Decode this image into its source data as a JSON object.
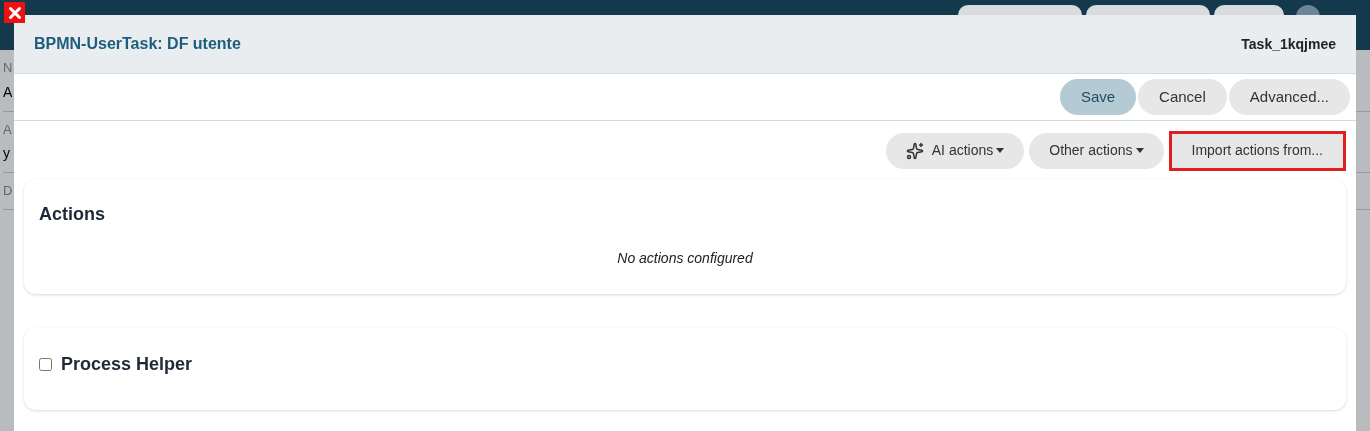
{
  "background": {
    "fields": [
      {
        "label": "N",
        "value": "A"
      },
      {
        "label": "A",
        "value": "y"
      },
      {
        "label": "D"
      }
    ]
  },
  "dialog": {
    "title": "BPMN-UserTask: DF utente",
    "task_id": "Task_1kqjmee",
    "close_marker": true,
    "buttons": [
      {
        "label": "Save",
        "primary": true
      },
      {
        "label": "Cancel",
        "primary": false
      },
      {
        "label": "Advanced...",
        "primary": false
      }
    ],
    "action_buttons": [
      {
        "label": "AI actions",
        "dropdown": true,
        "highlighted": false
      },
      {
        "label": "Other actions",
        "dropdown": true,
        "highlighted": false
      },
      {
        "label": "Import actions from...",
        "dropdown": false,
        "highlighted": true
      }
    ],
    "actions_card": {
      "title": "Actions",
      "empty_text": "No actions configured"
    },
    "helper_card": {
      "title": "Process Helper",
      "checked": false
    }
  }
}
